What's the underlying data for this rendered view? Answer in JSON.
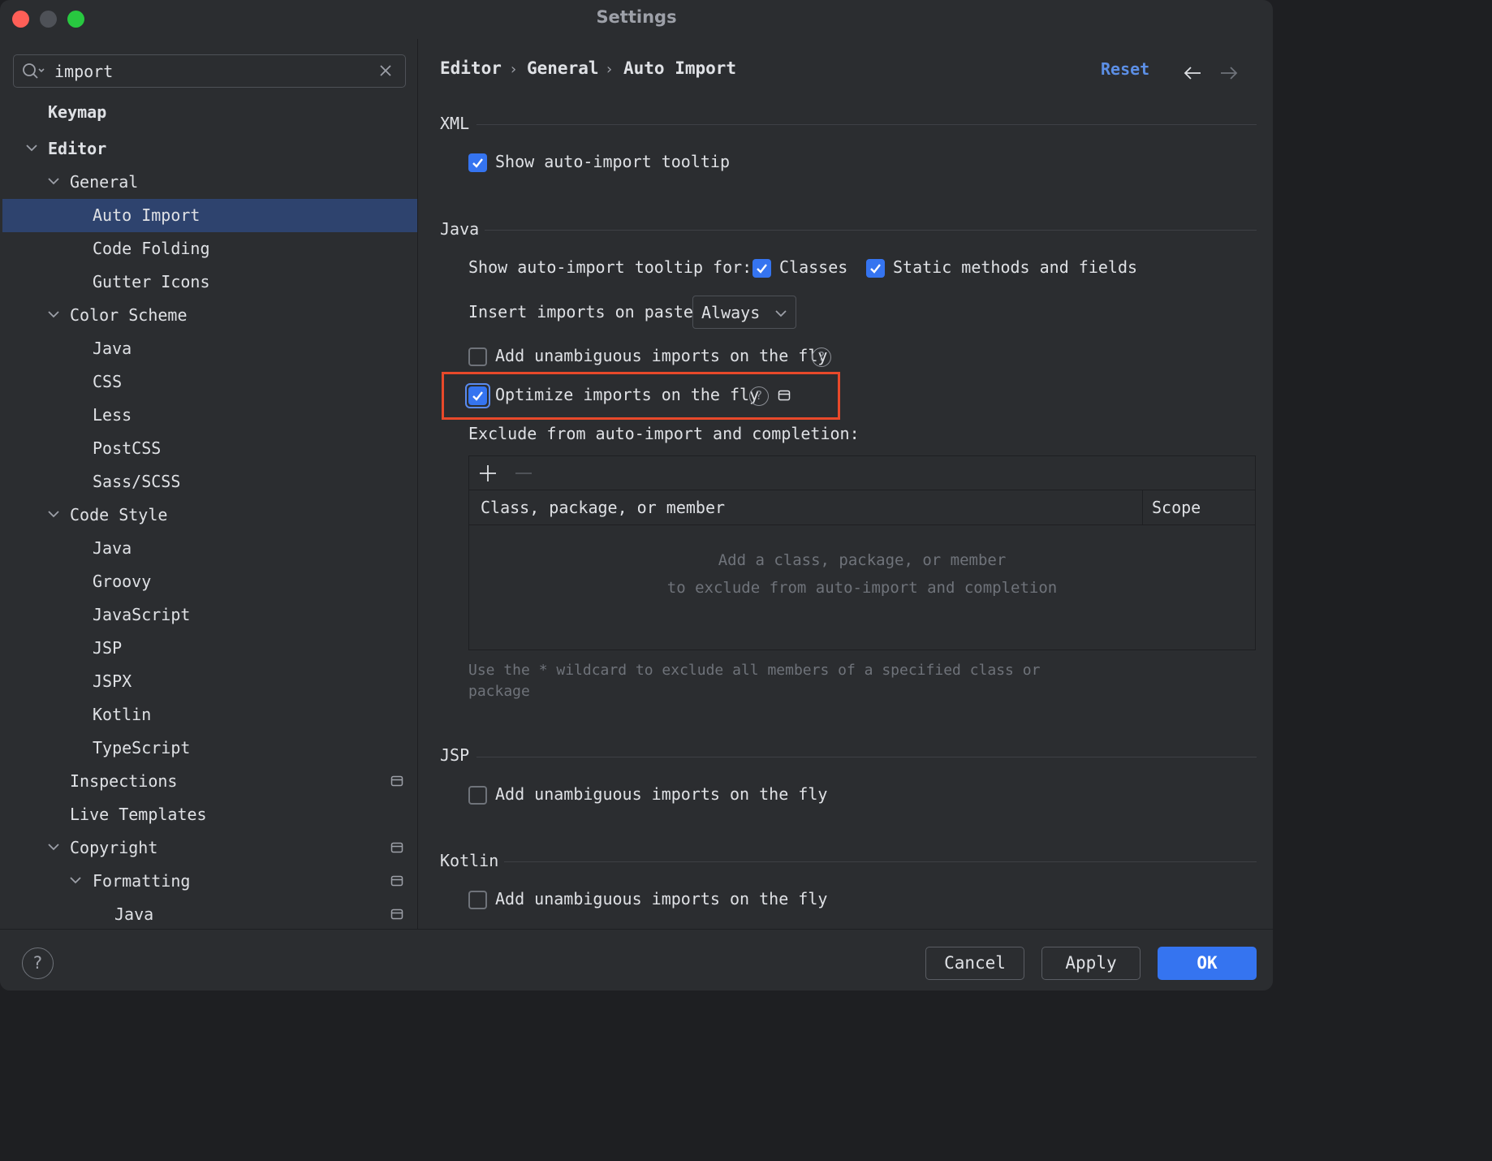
{
  "window": {
    "title": "Settings"
  },
  "search": {
    "value": "import"
  },
  "tree": [
    {
      "label": "Keymap"
    },
    {
      "label": "Editor"
    },
    {
      "label": "General"
    },
    {
      "label": "Auto Import"
    },
    {
      "label": "Code Folding"
    },
    {
      "label": "Gutter Icons"
    },
    {
      "label": "Color Scheme"
    },
    {
      "label": "Java"
    },
    {
      "label": "CSS"
    },
    {
      "label": "Less"
    },
    {
      "label": "PostCSS"
    },
    {
      "label": "Sass/SCSS"
    },
    {
      "label": "Code Style"
    },
    {
      "label": "Java"
    },
    {
      "label": "Groovy"
    },
    {
      "label": "JavaScript"
    },
    {
      "label": "JSP"
    },
    {
      "label": "JSPX"
    },
    {
      "label": "Kotlin"
    },
    {
      "label": "TypeScript"
    },
    {
      "label": "Inspections"
    },
    {
      "label": "Live Templates"
    },
    {
      "label": "Copyright"
    },
    {
      "label": "Formatting"
    },
    {
      "label": "Java"
    }
  ],
  "breadcrumb": [
    "Editor",
    "General",
    "Auto Import"
  ],
  "breadcrumb_separator": "›",
  "header": {
    "reset_label": "Reset"
  },
  "xml": {
    "title": "XML",
    "show_tooltip": {
      "label": "Show auto-import tooltip",
      "checked": true
    }
  },
  "java": {
    "title": "Java",
    "tooltip_for_label": "Show auto-import tooltip for:",
    "classes": {
      "label": "Classes",
      "checked": true
    },
    "static_members": {
      "label": "Static methods and fields",
      "checked": true
    },
    "paste_label": "Insert imports on paste:",
    "paste_value": "Always",
    "unambiguous": {
      "label": "Add unambiguous imports on the fly",
      "checked": false
    },
    "optimize": {
      "label": "Optimize imports on the fly",
      "checked": true
    },
    "exclude_label": "Exclude from auto-import and completion:",
    "table": {
      "columns": [
        "Class, package, or member",
        "Scope"
      ],
      "empty_lines": [
        "Add a class, package, or member",
        "to exclude from auto-import and completion"
      ]
    },
    "hint_lines": [
      "Use the * wildcard to exclude all members of a specified class or",
      "package"
    ]
  },
  "jsp": {
    "title": "JSP",
    "unambiguous": {
      "label": "Add unambiguous imports on the fly",
      "checked": false
    }
  },
  "kotlin": {
    "title": "Kotlin",
    "unambiguous": {
      "label": "Add unambiguous imports on the fly",
      "checked": false
    }
  },
  "footer": {
    "help": "?",
    "cancel": "Cancel",
    "apply": "Apply",
    "ok": "OK"
  },
  "colors": {
    "accent": "#3574f0",
    "selection": "#2e436e",
    "highlight_border": "#e8492a",
    "link": "#5c8fe6"
  }
}
